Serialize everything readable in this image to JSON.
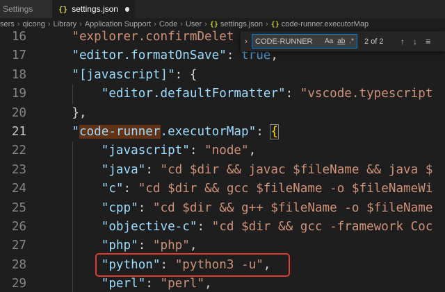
{
  "tabs": [
    {
      "label": "Settings",
      "active": false
    },
    {
      "label": "settings.json",
      "active": true,
      "dirty": true,
      "icon": "json-braces-icon"
    }
  ],
  "breadcrumb": [
    "sers",
    "qicong",
    "Library",
    "Application Support",
    "Code",
    "User",
    "settings.json",
    "code-runner.executorMap"
  ],
  "find": {
    "query": "CODE-RUNNER",
    "match_case": "Aa",
    "whole_word": "ab",
    "regex": ".*",
    "count": "2 of 2"
  },
  "lines": [
    {
      "n": "16",
      "t": "    \"explorer.confirmDelet"
    },
    {
      "n": "17",
      "t": "    \"editor.formatOnSave\": true,"
    },
    {
      "n": "18",
      "t": "    \"[javascript]\": {"
    },
    {
      "n": "19",
      "t": "        \"editor.defaultFormatter\": \"vscode.typescript"
    },
    {
      "n": "20",
      "t": "    },"
    },
    {
      "n": "21",
      "t": "    \"code-runner.executorMap\": {"
    },
    {
      "n": "22",
      "t": "        \"javascript\": \"node\","
    },
    {
      "n": "23",
      "t": "        \"java\": \"cd $dir && javac $fileName && java $"
    },
    {
      "n": "24",
      "t": "        \"c\": \"cd $dir && gcc $fileName -o $fileNameWi"
    },
    {
      "n": "25",
      "t": "        \"cpp\": \"cd $dir && g++ $fileName -o $fileName"
    },
    {
      "n": "26",
      "t": "        \"objective-c\": \"cd $dir && gcc -framework Coc"
    },
    {
      "n": "27",
      "t": "        \"php\": \"php\","
    },
    {
      "n": "28",
      "t": "        \"python\": \"python3 -u\","
    },
    {
      "n": "29",
      "t": "        \"perl\": \"perl\","
    }
  ],
  "colors": {
    "background": "#1e1e1e",
    "key": "#9cdcfe",
    "string": "#ce9178",
    "boolean": "#569cd6",
    "highlight_border": "#e23d2e",
    "find_match": "#613214"
  }
}
